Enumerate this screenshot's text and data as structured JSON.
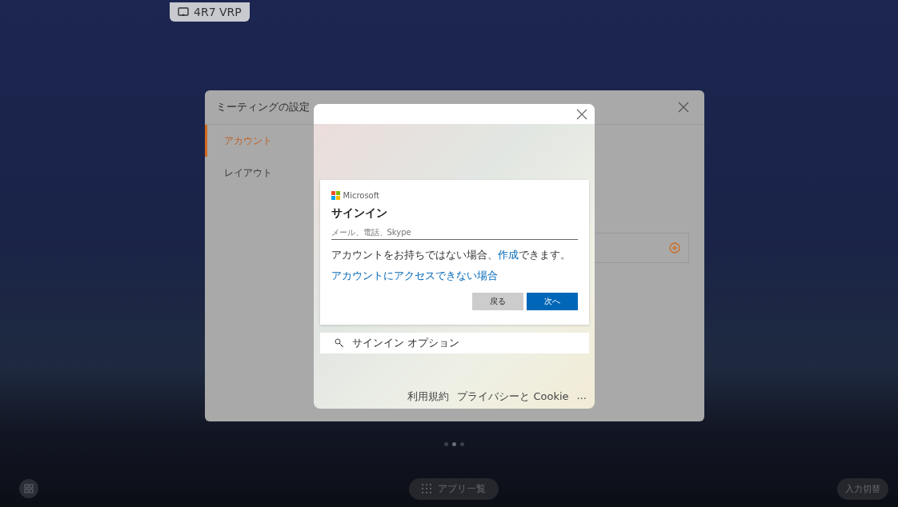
{
  "top_chip": {
    "label": "4R7 VRP"
  },
  "settings": {
    "title": "ミーティングの設定",
    "sidebar": [
      {
        "label": "アカウント",
        "selected": true
      },
      {
        "label": "レイアウト",
        "selected": false
      }
    ]
  },
  "signin_popup": {
    "brand": "Microsoft",
    "title": "サインイン",
    "email_field": {
      "placeholder": "メール、電話、Skype"
    },
    "no_account": {
      "before": "アカウントをお持ちではない場合、",
      "link": "作成",
      "after": "できます。"
    },
    "cant_access_link": "アカウントにアクセスできない場合",
    "buttons": [
      {
        "label": "戻る",
        "kind": "secondary"
      },
      {
        "label": "次へ",
        "kind": "primary"
      }
    ],
    "signin_options": "サインイン オプション",
    "footer_links": [
      "利用規約",
      "プライバシーと Cookie",
      "..."
    ]
  },
  "pager": [
    {
      "selected": false
    },
    {
      "selected": true
    },
    {
      "selected": false
    }
  ],
  "bottom_bar": {
    "apps_button": "アプリ一覧",
    "input_switch_button": "入力切替"
  }
}
